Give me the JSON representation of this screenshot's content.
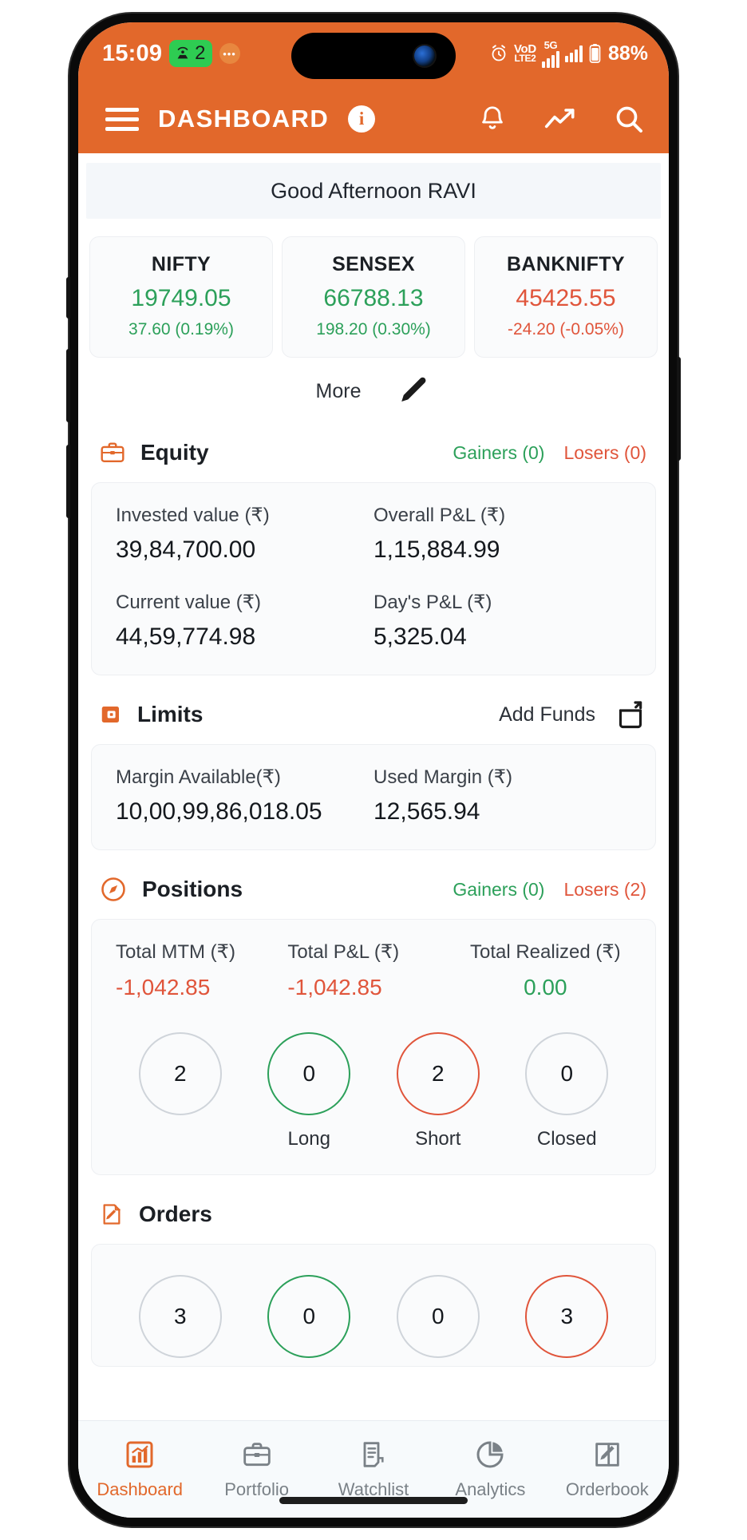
{
  "status_bar": {
    "time": "15:09",
    "hotspot_count": "2",
    "chat_icon": "chat-bubble-icon",
    "alarm_icon": "alarm-clock-icon",
    "volte_top": "VoD",
    "volte_bottom": "LTE2",
    "network_type": "5G",
    "battery": "88%"
  },
  "app_bar": {
    "menu_icon": "hamburger-menu-icon",
    "title": "DASHBOARD",
    "info_icon": "i",
    "bell_icon": "notification-bell-icon",
    "trending_icon": "trending-up-icon",
    "search_icon": "search-icon"
  },
  "greeting": "Good Afternoon RAVI",
  "indices": [
    {
      "name": "NIFTY",
      "value": "19749.05",
      "change": "37.60  (0.19%)",
      "direction": "up"
    },
    {
      "name": "SENSEX",
      "value": "66788.13",
      "change": "198.20  (0.30%)",
      "direction": "up"
    },
    {
      "name": "BANKNIFTY",
      "value": "45425.55",
      "change": "-24.20  (-0.05%)",
      "direction": "down"
    }
  ],
  "more": {
    "label": "More",
    "edit_icon": "pencil-edit-icon"
  },
  "equity": {
    "icon": "briefcase-icon",
    "title": "Equity",
    "gainers": "Gainers (0)",
    "losers": "Losers (0)",
    "invested_label": "Invested value (₹)",
    "invested_value": "39,84,700.00",
    "overall_pl_label": "Overall P&L (₹)",
    "overall_pl_value": "1,15,884.99",
    "current_label": "Current value (₹)",
    "current_value": "44,59,774.98",
    "days_pl_label": "Day's P&L (₹)",
    "days_pl_value": "5,325.04"
  },
  "limits": {
    "icon": "wallet-icon",
    "title": "Limits",
    "add_funds": "Add Funds",
    "add_funds_icon": "add-funds-upload-icon",
    "margin_available_label": "Margin Available(₹)",
    "margin_available_value": "10,00,99,86,018.05",
    "used_margin_label": "Used Margin (₹)",
    "used_margin_value": "12,565.94"
  },
  "positions": {
    "icon": "compass-icon",
    "title": "Positions",
    "gainers": "Gainers (0)",
    "losers": "Losers (2)",
    "total_mtm_label": "Total MTM (₹)",
    "total_mtm_value": "-1,042.85",
    "total_pl_label": "Total P&L (₹)",
    "total_pl_value": "-1,042.85",
    "total_realized_label": "Total Realized  (₹)",
    "total_realized_value": "0.00",
    "circles": [
      {
        "count": "2",
        "label": "",
        "color": "grey"
      },
      {
        "count": "0",
        "label": "Long",
        "color": "green"
      },
      {
        "count": "2",
        "label": "Short",
        "color": "red"
      },
      {
        "count": "0",
        "label": "Closed",
        "color": "grey"
      }
    ]
  },
  "orders": {
    "icon": "orders-edit-icon",
    "title": "Orders",
    "circles": [
      {
        "count": "3",
        "color": "grey"
      },
      {
        "count": "0",
        "color": "green"
      },
      {
        "count": "0",
        "color": "grey"
      },
      {
        "count": "3",
        "color": "red"
      }
    ]
  },
  "bottom_nav": [
    {
      "label": "Dashboard",
      "icon": "dashboard-chart-icon",
      "active": true
    },
    {
      "label": "Portfolio",
      "icon": "briefcase-icon",
      "active": false
    },
    {
      "label": "Watchlist",
      "icon": "list-document-icon",
      "active": false
    },
    {
      "label": "Analytics",
      "icon": "pie-chart-icon",
      "active": false
    },
    {
      "label": "Orderbook",
      "icon": "edit-square-icon",
      "active": false
    }
  ],
  "colors": {
    "brand": "#E2682B",
    "up": "#2CA05A",
    "down": "#E0553B"
  }
}
